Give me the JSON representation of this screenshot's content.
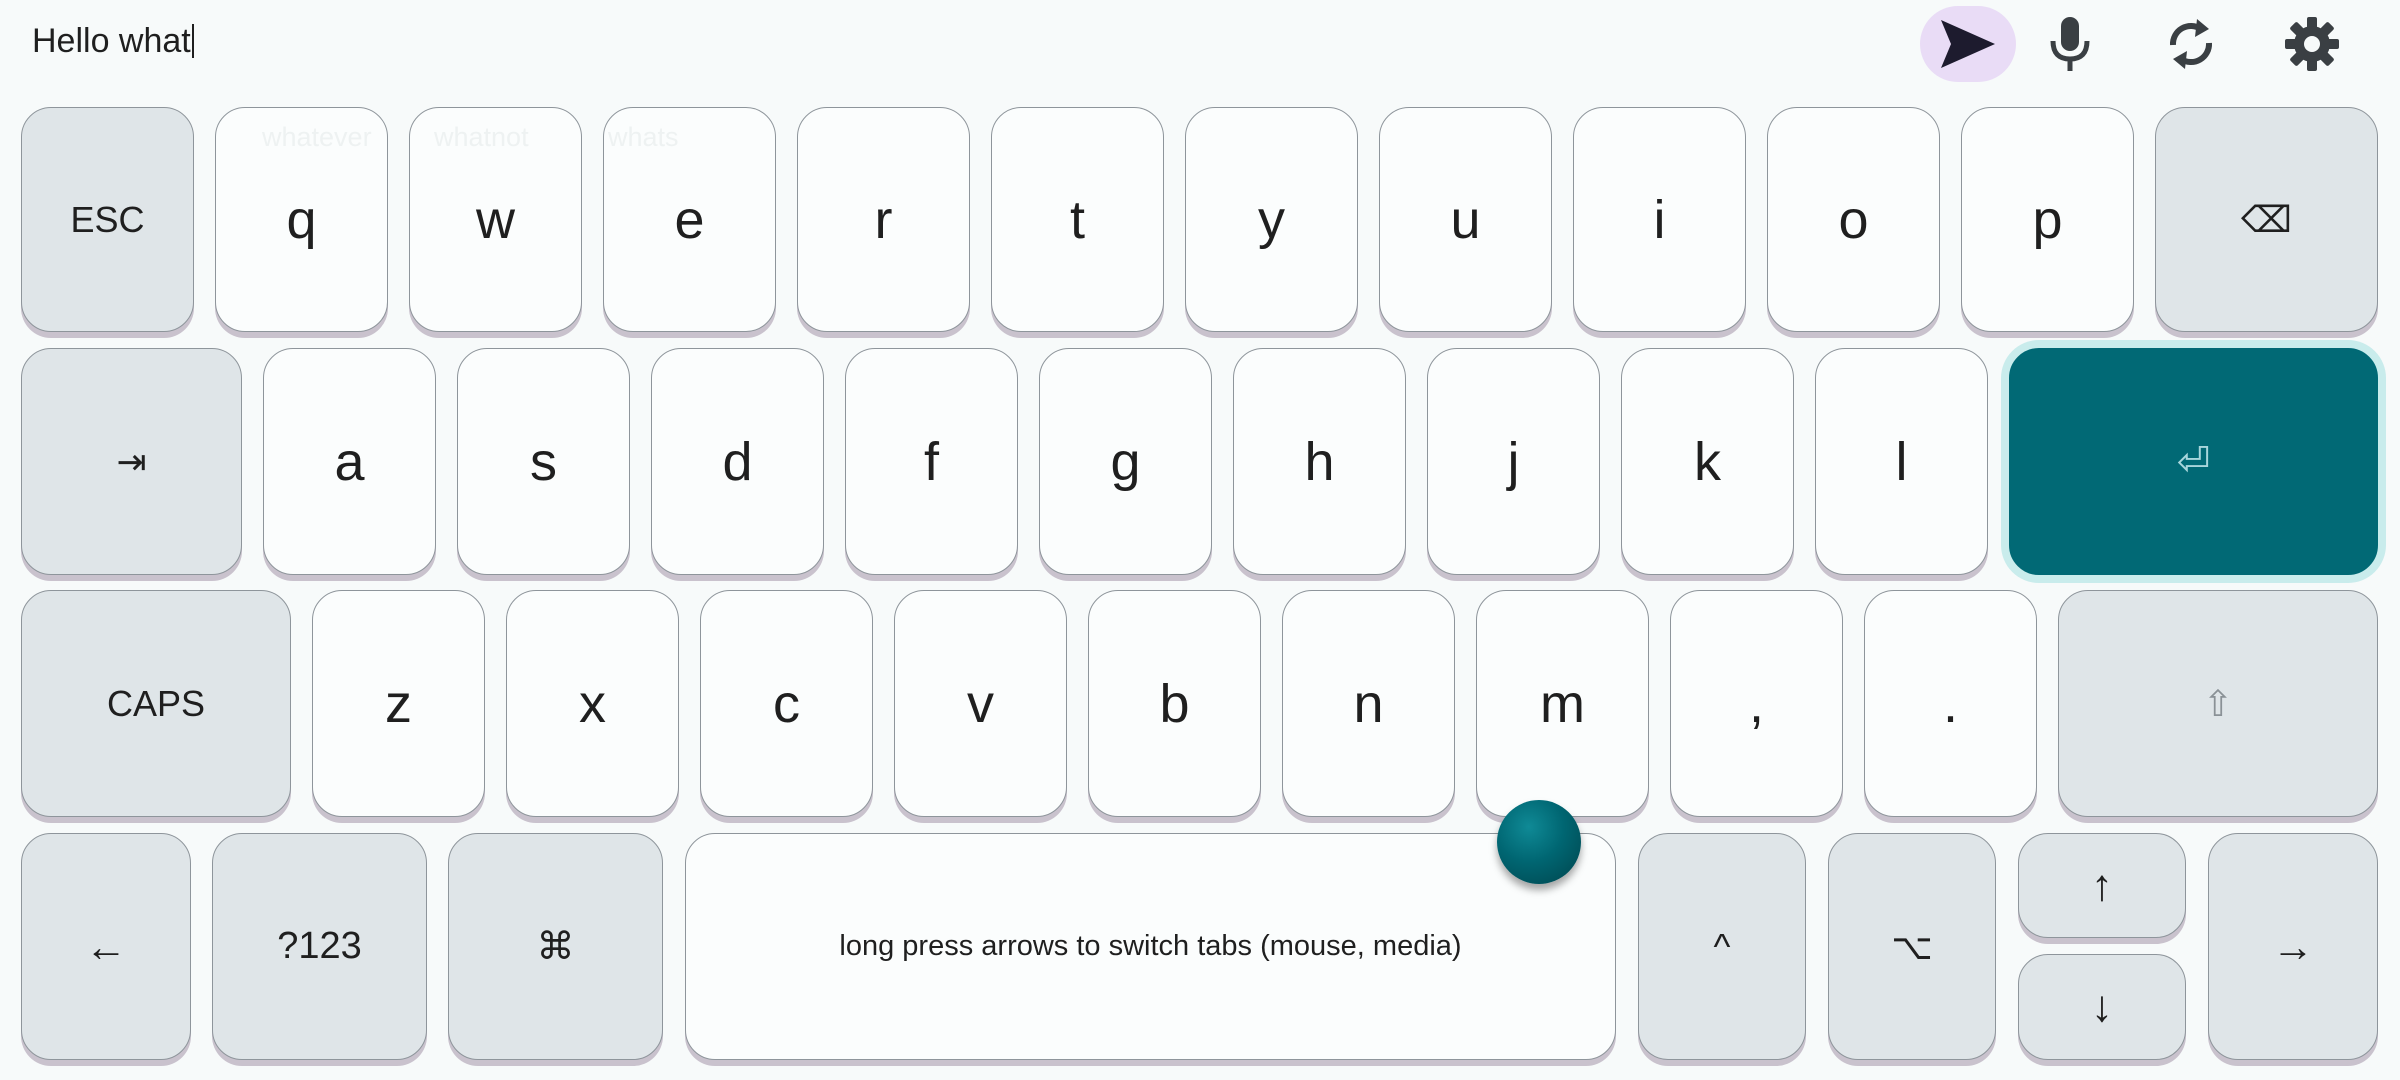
{
  "input": {
    "text": "Hello what"
  },
  "toolbar": {
    "send_icon": "send-icon",
    "mic_icon": "microphone-icon",
    "sync_icon": "sync-icon",
    "settings_icon": "gear-icon"
  },
  "suggestions": [
    "whatever",
    "whatnot",
    "whats"
  ],
  "keys": {
    "esc": "ESC",
    "q": "q",
    "w": "w",
    "e": "e",
    "r": "r",
    "t": "t",
    "y": "y",
    "u": "u",
    "i": "i",
    "o": "o",
    "p": "p",
    "backspace": "⌫",
    "tab": "⇥",
    "a": "a",
    "s": "s",
    "d": "d",
    "f": "f",
    "g": "g",
    "h": "h",
    "j": "j",
    "k": "k",
    "l": "l",
    "enter": "⏎",
    "caps": "CAPS",
    "z": "z",
    "x": "x",
    "c": "c",
    "v": "v",
    "b": "b",
    "n": "n",
    "m": "m",
    "comma": ",",
    "period": ".",
    "shift": "⇧",
    "left": "←",
    "numbers": "?123",
    "cmd": "⌘",
    "space": "long press arrows to switch tabs (mouse, media)",
    "ctrl": "^",
    "alt": "⌥",
    "up": "↑",
    "down": "↓",
    "right": "→"
  },
  "colors": {
    "accent": "#016975",
    "send_bg": "#e9dcf6",
    "modifier_key": "#dfe5e8",
    "letter_key": "#fbfdfd"
  }
}
